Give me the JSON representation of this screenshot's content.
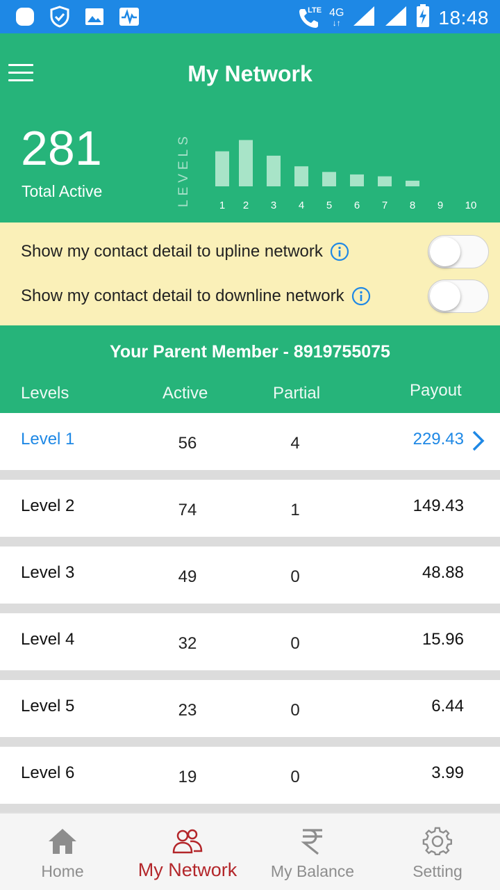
{
  "status_bar": {
    "network_type": "4G",
    "lte": "LTE",
    "time": "18:48"
  },
  "header": {
    "title": "My Network",
    "total_active_count": "281",
    "total_active_label": "Total Active",
    "levels_axis_label": "LEVELS"
  },
  "chart_data": {
    "type": "bar",
    "categories": [
      "1",
      "2",
      "3",
      "4",
      "5",
      "6",
      "7",
      "8",
      "9",
      "10"
    ],
    "values": [
      56,
      74,
      49,
      32,
      23,
      19,
      16,
      9,
      0,
      0
    ],
    "xlabel": "",
    "ylabel": "LEVELS",
    "ylim": [
      0,
      80
    ],
    "bar_color": "#a8e4c8"
  },
  "toggles": [
    {
      "label": "Show my contact detail to upline network",
      "enabled": false
    },
    {
      "label": "Show my contact detail to downline network",
      "enabled": false
    }
  ],
  "parent_member": "Your Parent Member - 8919755075",
  "columns": {
    "levels": "Levels",
    "active": "Active",
    "partial": "Partial",
    "payout": "Payout"
  },
  "rows": [
    {
      "level": "Level 1",
      "active": "56",
      "partial": "4",
      "payout": "229.43"
    },
    {
      "level": "Level 2",
      "active": "74",
      "partial": "1",
      "payout": "149.43"
    },
    {
      "level": "Level 3",
      "active": "49",
      "partial": "0",
      "payout": "48.88"
    },
    {
      "level": "Level 4",
      "active": "32",
      "partial": "0",
      "payout": "15.96"
    },
    {
      "level": "Level 5",
      "active": "23",
      "partial": "0",
      "payout": "6.44"
    },
    {
      "level": "Level 6",
      "active": "19",
      "partial": "0",
      "payout": "3.99"
    }
  ],
  "bottom_nav": {
    "home": "Home",
    "my_network": "My Network",
    "my_balance": "My Balance",
    "setting": "Setting"
  },
  "colors": {
    "primary_green": "#26b47a",
    "status_blue": "#1e88e5",
    "highlight_panel": "#faf0b8",
    "selected_nav": "#b3262a",
    "link_blue": "#1e88e5"
  }
}
